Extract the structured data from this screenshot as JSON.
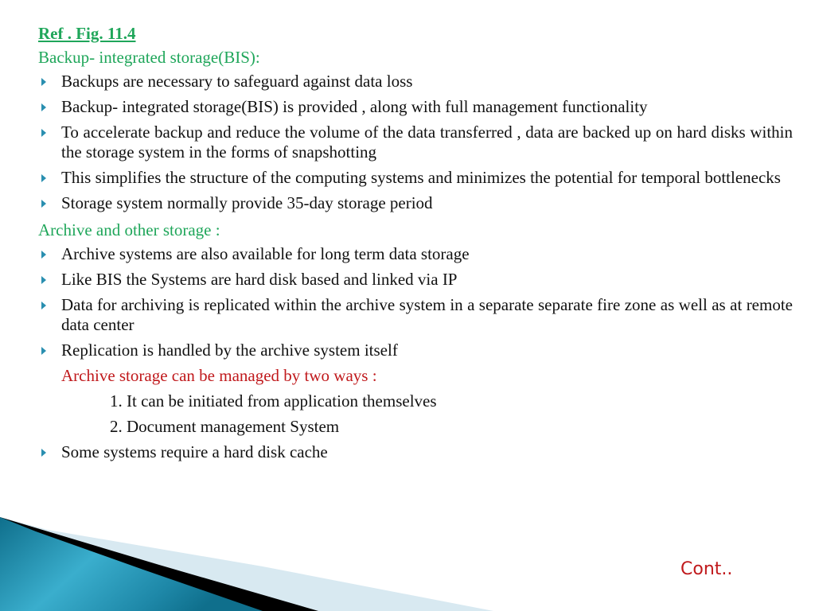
{
  "slide": {
    "ref_label": "Ref . Fig. 11.4",
    "section1": {
      "heading": "Backup- integrated storage(BIS):",
      "bullets": [
        "Backups are necessary to safeguard against data loss",
        "Backup- integrated storage(BIS) is provided , along with full management functionality",
        "To accelerate backup and reduce the volume of the data transferred , data are backed up on hard disks within the storage system in the forms of snapshotting",
        "This simplifies the structure of the computing systems and minimizes the potential for temporal bottlenecks",
        "Storage system normally provide 35-day storage period"
      ]
    },
    "section2": {
      "heading": "Archive and other storage :",
      "bullets": [
        "Archive systems are also available for long term data storage",
        "Like BIS the Systems are hard disk based and linked via IP",
        "Data for archiving is replicated within the archive system in a separate separate fire zone as well as at remote data center",
        "Replication is handled by the archive system itself"
      ],
      "subheading": "Archive storage can be managed by two ways :",
      "numbered": [
        "1. It can be initiated from application themselves",
        "2. Document management System"
      ],
      "last_bullet": "Some systems require a hard disk cache"
    },
    "continue_label": "Cont..",
    "colors": {
      "heading_green": "#1fa65a",
      "accent_red": "#c0191c",
      "bullet_blue": "#2a8fb0"
    }
  }
}
